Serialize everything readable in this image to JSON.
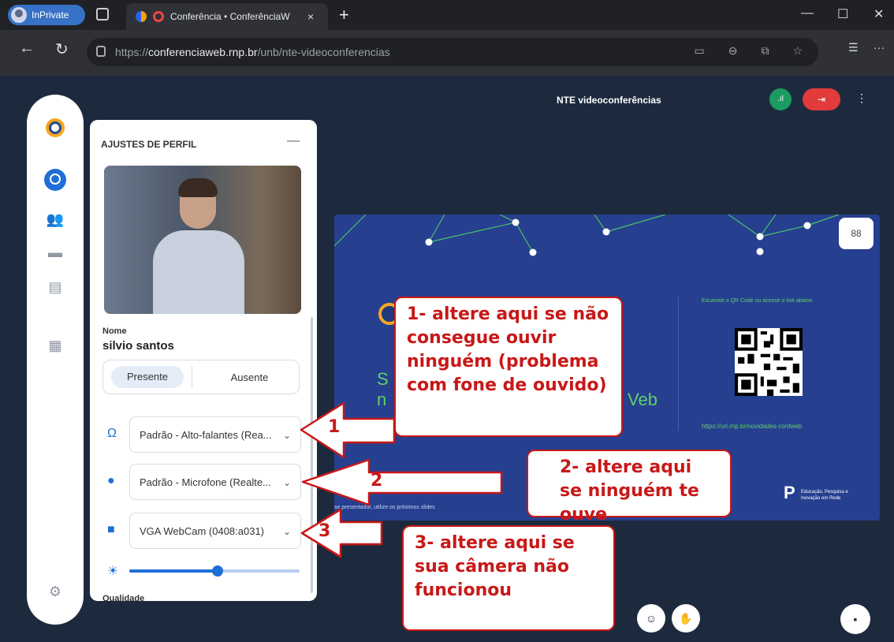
{
  "browser": {
    "inprivate_label": "InPrivate",
    "tab_title": "Conferência • ConferênciaW",
    "tab_close": "×",
    "new_tab": "+",
    "url_prefix": "https://",
    "url_domain": "conferenciaweb.rnp.br",
    "url_path": "/unb/nte-videoconferencias",
    "window_controls": [
      "—",
      "☐",
      "✕"
    ]
  },
  "header": {
    "meeting_title": "NTE videoconferências",
    "connection_icon": "signal-icon",
    "leave_icon": "leave-icon",
    "menu_icon": "more-vertical-icon"
  },
  "sidebar": {
    "items": [
      "logo",
      "profile-icon",
      "participants-icon",
      "chat-icon",
      "notes-icon",
      "apps-icon",
      "settings-icon"
    ]
  },
  "profile": {
    "title": "AJUSTES DE PERFIL",
    "minimize": "—",
    "name_label": "Nome",
    "name": "silvio santos",
    "status_present": "Presente",
    "status_absent": "Ausente",
    "speaker": "Padrão - Alto-falantes (Rea...",
    "microphone": "Padrão - Microfone (Realte...",
    "camera": "VGA WebCam (0408:a031)",
    "brightness": 0.52,
    "quality_label": "Qualidade"
  },
  "slide": {
    "title_line1": "S",
    "title_line2": "n",
    "title_tail": "Veb",
    "scan_text": "Escaneie o QR Code ou acesse o link abaixo",
    "link": "https://url.rnp.br/novidades-confweb",
    "footer": "se presentador, utilize os próximos slides",
    "rnp": "P",
    "rnp_sub": "Educação, Pesquisa e Inovação em Rede",
    "accent_color": "#5fd06a",
    "background_color": "#263f8f"
  },
  "annotations": {
    "callout1": "1- altere aqui  se não consegue ouvir ninguém (problema com fone de ouvido)",
    "callout2": "2- altere aqui se ninguém te ouve",
    "callout3": "3- altere aqui se sua câmera não funcionou",
    "num1": "1",
    "num2": "2",
    "num3": "3",
    "color": "#c81818"
  }
}
